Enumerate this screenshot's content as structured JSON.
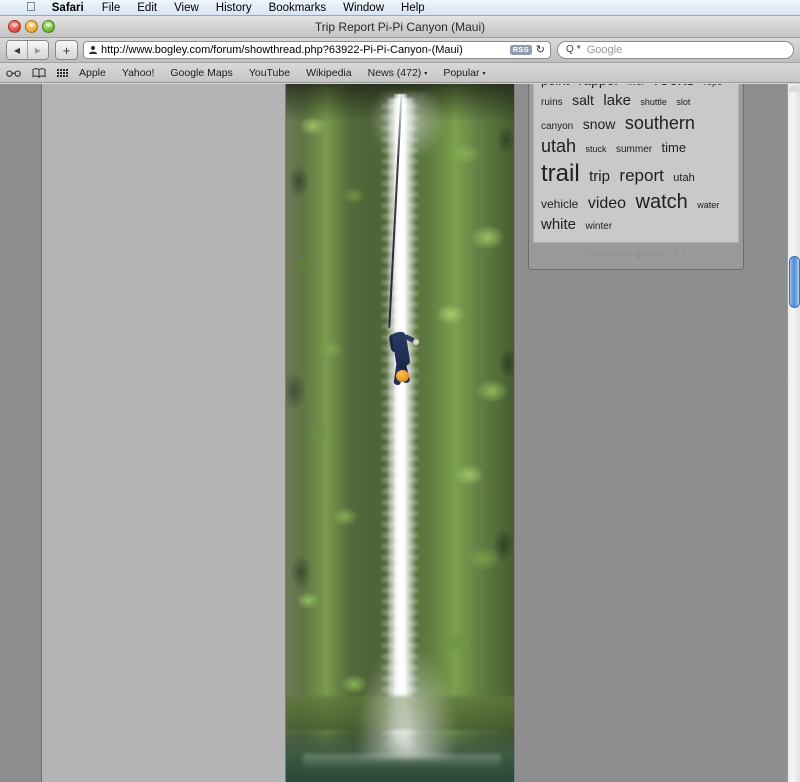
{
  "menubar": {
    "apple_glyph": "apple-logo",
    "items": [
      {
        "label": "Safari",
        "bold": true
      },
      {
        "label": "File"
      },
      {
        "label": "Edit"
      },
      {
        "label": "View"
      },
      {
        "label": "History"
      },
      {
        "label": "Bookmarks"
      },
      {
        "label": "Window"
      },
      {
        "label": "Help"
      }
    ]
  },
  "window": {
    "title": "Trip Report Pi-Pi Canyon (Maui)",
    "controls": [
      "close-button",
      "minimize-button",
      "zoom-button"
    ]
  },
  "toolbar": {
    "back_glyph": "◀",
    "forward_glyph": "▶",
    "add_bookmark_glyph": "+",
    "url": "http://www.bogley.com/forum/showthread.php?63922-Pi-Pi-Canyon-(Maui)",
    "rss_label": "RSS",
    "reload_glyph": "↻",
    "search_placeholder": "Google",
    "search_value": "",
    "search_glyph": "Q"
  },
  "bookmarks_bar": {
    "icons": [
      "reading-glasses-icon",
      "book-icon",
      "grid-icon"
    ],
    "items": [
      {
        "label": "Apple",
        "has_menu": false
      },
      {
        "label": "Yahoo!",
        "has_menu": false
      },
      {
        "label": "Google Maps",
        "has_menu": false
      },
      {
        "label": "YouTube",
        "has_menu": false
      },
      {
        "label": "Wikipedia",
        "has_menu": false
      },
      {
        "label": "News (472)",
        "has_menu": true
      },
      {
        "label": "Popular",
        "has_menu": true
      }
    ],
    "caret_glyph": "▾"
  },
  "page": {
    "photo": {
      "alt": "Tall waterfall in a lush green canyon with a canyoneer rappelling alongside the falls into a plunge pool",
      "subject": "waterfall-photo"
    },
    "tag_cloud": {
      "tags": [
        {
          "text": "point",
          "size": 13
        },
        {
          "text": "rappel",
          "size": 14
        },
        {
          "text": "river",
          "size": 9
        },
        {
          "text": "rocks",
          "size": 17
        },
        {
          "text": "rope",
          "size": 9
        },
        {
          "text": "ruins",
          "size": 10
        },
        {
          "text": "salt",
          "size": 14
        },
        {
          "text": "lake",
          "size": 15
        },
        {
          "text": "shuttle",
          "size": 9
        },
        {
          "text": "slot",
          "size": 9
        },
        {
          "text": "canyon",
          "size": 10
        },
        {
          "text": "snow",
          "size": 14
        },
        {
          "text": "southern",
          "size": 18
        },
        {
          "text": "utah",
          "size": 18
        },
        {
          "text": "stuck",
          "size": 9
        },
        {
          "text": "summer",
          "size": 10
        },
        {
          "text": "time",
          "size": 13
        },
        {
          "text": "trail",
          "size": 24
        },
        {
          "text": "trip",
          "size": 15
        },
        {
          "text": "report",
          "size": 17
        },
        {
          "text": "utah",
          "size": 11
        },
        {
          "text": "vehicle",
          "size": 12
        },
        {
          "text": "video",
          "size": 16
        },
        {
          "text": "watch",
          "size": 20
        },
        {
          "text": "water",
          "size": 9
        },
        {
          "text": "white",
          "size": 15
        },
        {
          "text": "winter",
          "size": 10
        }
      ],
      "footer": "Everywhere gSidaa 1.5.1"
    }
  },
  "scrollbar": {
    "orientation": "vertical",
    "thumb_position_percent": 25
  },
  "colors": {
    "menubar_bg": "#e4eef8",
    "window_chrome": "#cbcbcb",
    "page_bg": "#b4b4b4",
    "page_surround": "#8e8e8e",
    "scrollbar_thumb": "#4e8ddb",
    "tagcloud_bg": "#c9c9c9",
    "widget_bg": "#9a9a9a"
  }
}
